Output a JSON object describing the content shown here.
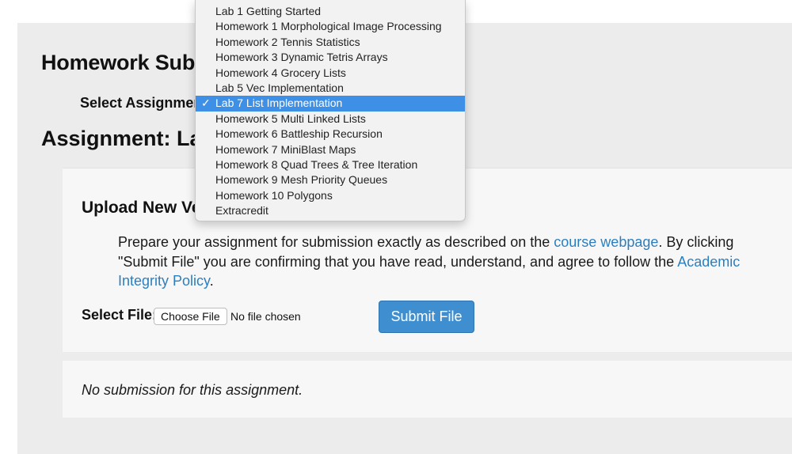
{
  "page": {
    "title": "Homework Submission",
    "select_label": "Select Assignment:",
    "assignment_title": "Assignment: Lab 7 List Implementation"
  },
  "dropdown": {
    "selected_index": 6,
    "checkmark": "✓",
    "options": [
      "Lab 1 Getting Started",
      "Homework 1 Morphological Image Processing",
      "Homework 2 Tennis Statistics",
      "Homework 3 Dynamic Tetris Arrays",
      "Homework 4 Grocery Lists",
      "Lab 5 Vec Implementation",
      "Lab 7 List Implementation",
      "Homework 5 Multi Linked Lists",
      "Homework 6 Battleship Recursion",
      "Homework 7 MiniBlast Maps",
      "Homework 8 Quad Trees & Tree Iteration",
      "Homework 9 Mesh Priority Queues",
      "Homework 10 Polygons",
      "Extracredit"
    ]
  },
  "upload": {
    "heading": "Upload New Version",
    "instructions": {
      "part1": "Prepare your assignment for submission exactly as described on the ",
      "link1": "course webpage",
      "part2": ". By clicking \"Submit File\" you are confirming that you have read, understand, and agree to follow the ",
      "link2": "Academic Integrity Policy",
      "part3": "."
    },
    "file_label": "Select File:",
    "choose_label": "Choose File",
    "no_file_text": "No file chosen",
    "submit_label": "Submit File"
  },
  "status": {
    "text": "No submission for this assignment."
  },
  "colors": {
    "link": "#2c7fbf",
    "submit_button": "#3f8fd0",
    "selected_option": "#3e8fe6",
    "panel_background": "#ececec"
  }
}
